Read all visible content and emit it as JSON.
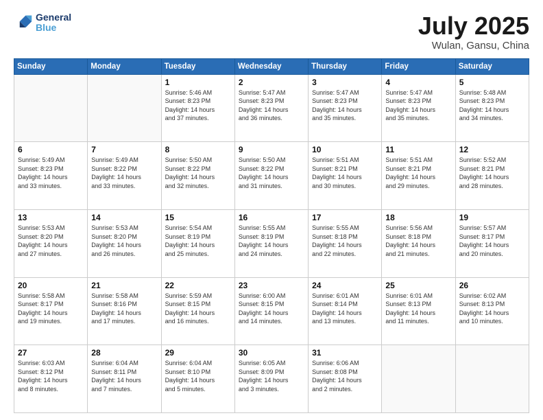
{
  "header": {
    "logo_line1": "General",
    "logo_line2": "Blue",
    "month": "July 2025",
    "location": "Wulan, Gansu, China"
  },
  "weekdays": [
    "Sunday",
    "Monday",
    "Tuesday",
    "Wednesday",
    "Thursday",
    "Friday",
    "Saturday"
  ],
  "weeks": [
    [
      {
        "day": "",
        "text": ""
      },
      {
        "day": "",
        "text": ""
      },
      {
        "day": "1",
        "text": "Sunrise: 5:46 AM\nSunset: 8:23 PM\nDaylight: 14 hours\nand 37 minutes."
      },
      {
        "day": "2",
        "text": "Sunrise: 5:47 AM\nSunset: 8:23 PM\nDaylight: 14 hours\nand 36 minutes."
      },
      {
        "day": "3",
        "text": "Sunrise: 5:47 AM\nSunset: 8:23 PM\nDaylight: 14 hours\nand 35 minutes."
      },
      {
        "day": "4",
        "text": "Sunrise: 5:47 AM\nSunset: 8:23 PM\nDaylight: 14 hours\nand 35 minutes."
      },
      {
        "day": "5",
        "text": "Sunrise: 5:48 AM\nSunset: 8:23 PM\nDaylight: 14 hours\nand 34 minutes."
      }
    ],
    [
      {
        "day": "6",
        "text": "Sunrise: 5:49 AM\nSunset: 8:23 PM\nDaylight: 14 hours\nand 33 minutes."
      },
      {
        "day": "7",
        "text": "Sunrise: 5:49 AM\nSunset: 8:22 PM\nDaylight: 14 hours\nand 33 minutes."
      },
      {
        "day": "8",
        "text": "Sunrise: 5:50 AM\nSunset: 8:22 PM\nDaylight: 14 hours\nand 32 minutes."
      },
      {
        "day": "9",
        "text": "Sunrise: 5:50 AM\nSunset: 8:22 PM\nDaylight: 14 hours\nand 31 minutes."
      },
      {
        "day": "10",
        "text": "Sunrise: 5:51 AM\nSunset: 8:21 PM\nDaylight: 14 hours\nand 30 minutes."
      },
      {
        "day": "11",
        "text": "Sunrise: 5:51 AM\nSunset: 8:21 PM\nDaylight: 14 hours\nand 29 minutes."
      },
      {
        "day": "12",
        "text": "Sunrise: 5:52 AM\nSunset: 8:21 PM\nDaylight: 14 hours\nand 28 minutes."
      }
    ],
    [
      {
        "day": "13",
        "text": "Sunrise: 5:53 AM\nSunset: 8:20 PM\nDaylight: 14 hours\nand 27 minutes."
      },
      {
        "day": "14",
        "text": "Sunrise: 5:53 AM\nSunset: 8:20 PM\nDaylight: 14 hours\nand 26 minutes."
      },
      {
        "day": "15",
        "text": "Sunrise: 5:54 AM\nSunset: 8:19 PM\nDaylight: 14 hours\nand 25 minutes."
      },
      {
        "day": "16",
        "text": "Sunrise: 5:55 AM\nSunset: 8:19 PM\nDaylight: 14 hours\nand 24 minutes."
      },
      {
        "day": "17",
        "text": "Sunrise: 5:55 AM\nSunset: 8:18 PM\nDaylight: 14 hours\nand 22 minutes."
      },
      {
        "day": "18",
        "text": "Sunrise: 5:56 AM\nSunset: 8:18 PM\nDaylight: 14 hours\nand 21 minutes."
      },
      {
        "day": "19",
        "text": "Sunrise: 5:57 AM\nSunset: 8:17 PM\nDaylight: 14 hours\nand 20 minutes."
      }
    ],
    [
      {
        "day": "20",
        "text": "Sunrise: 5:58 AM\nSunset: 8:17 PM\nDaylight: 14 hours\nand 19 minutes."
      },
      {
        "day": "21",
        "text": "Sunrise: 5:58 AM\nSunset: 8:16 PM\nDaylight: 14 hours\nand 17 minutes."
      },
      {
        "day": "22",
        "text": "Sunrise: 5:59 AM\nSunset: 8:15 PM\nDaylight: 14 hours\nand 16 minutes."
      },
      {
        "day": "23",
        "text": "Sunrise: 6:00 AM\nSunset: 8:15 PM\nDaylight: 14 hours\nand 14 minutes."
      },
      {
        "day": "24",
        "text": "Sunrise: 6:01 AM\nSunset: 8:14 PM\nDaylight: 14 hours\nand 13 minutes."
      },
      {
        "day": "25",
        "text": "Sunrise: 6:01 AM\nSunset: 8:13 PM\nDaylight: 14 hours\nand 11 minutes."
      },
      {
        "day": "26",
        "text": "Sunrise: 6:02 AM\nSunset: 8:13 PM\nDaylight: 14 hours\nand 10 minutes."
      }
    ],
    [
      {
        "day": "27",
        "text": "Sunrise: 6:03 AM\nSunset: 8:12 PM\nDaylight: 14 hours\nand 8 minutes."
      },
      {
        "day": "28",
        "text": "Sunrise: 6:04 AM\nSunset: 8:11 PM\nDaylight: 14 hours\nand 7 minutes."
      },
      {
        "day": "29",
        "text": "Sunrise: 6:04 AM\nSunset: 8:10 PM\nDaylight: 14 hours\nand 5 minutes."
      },
      {
        "day": "30",
        "text": "Sunrise: 6:05 AM\nSunset: 8:09 PM\nDaylight: 14 hours\nand 3 minutes."
      },
      {
        "day": "31",
        "text": "Sunrise: 6:06 AM\nSunset: 8:08 PM\nDaylight: 14 hours\nand 2 minutes."
      },
      {
        "day": "",
        "text": ""
      },
      {
        "day": "",
        "text": ""
      }
    ]
  ]
}
